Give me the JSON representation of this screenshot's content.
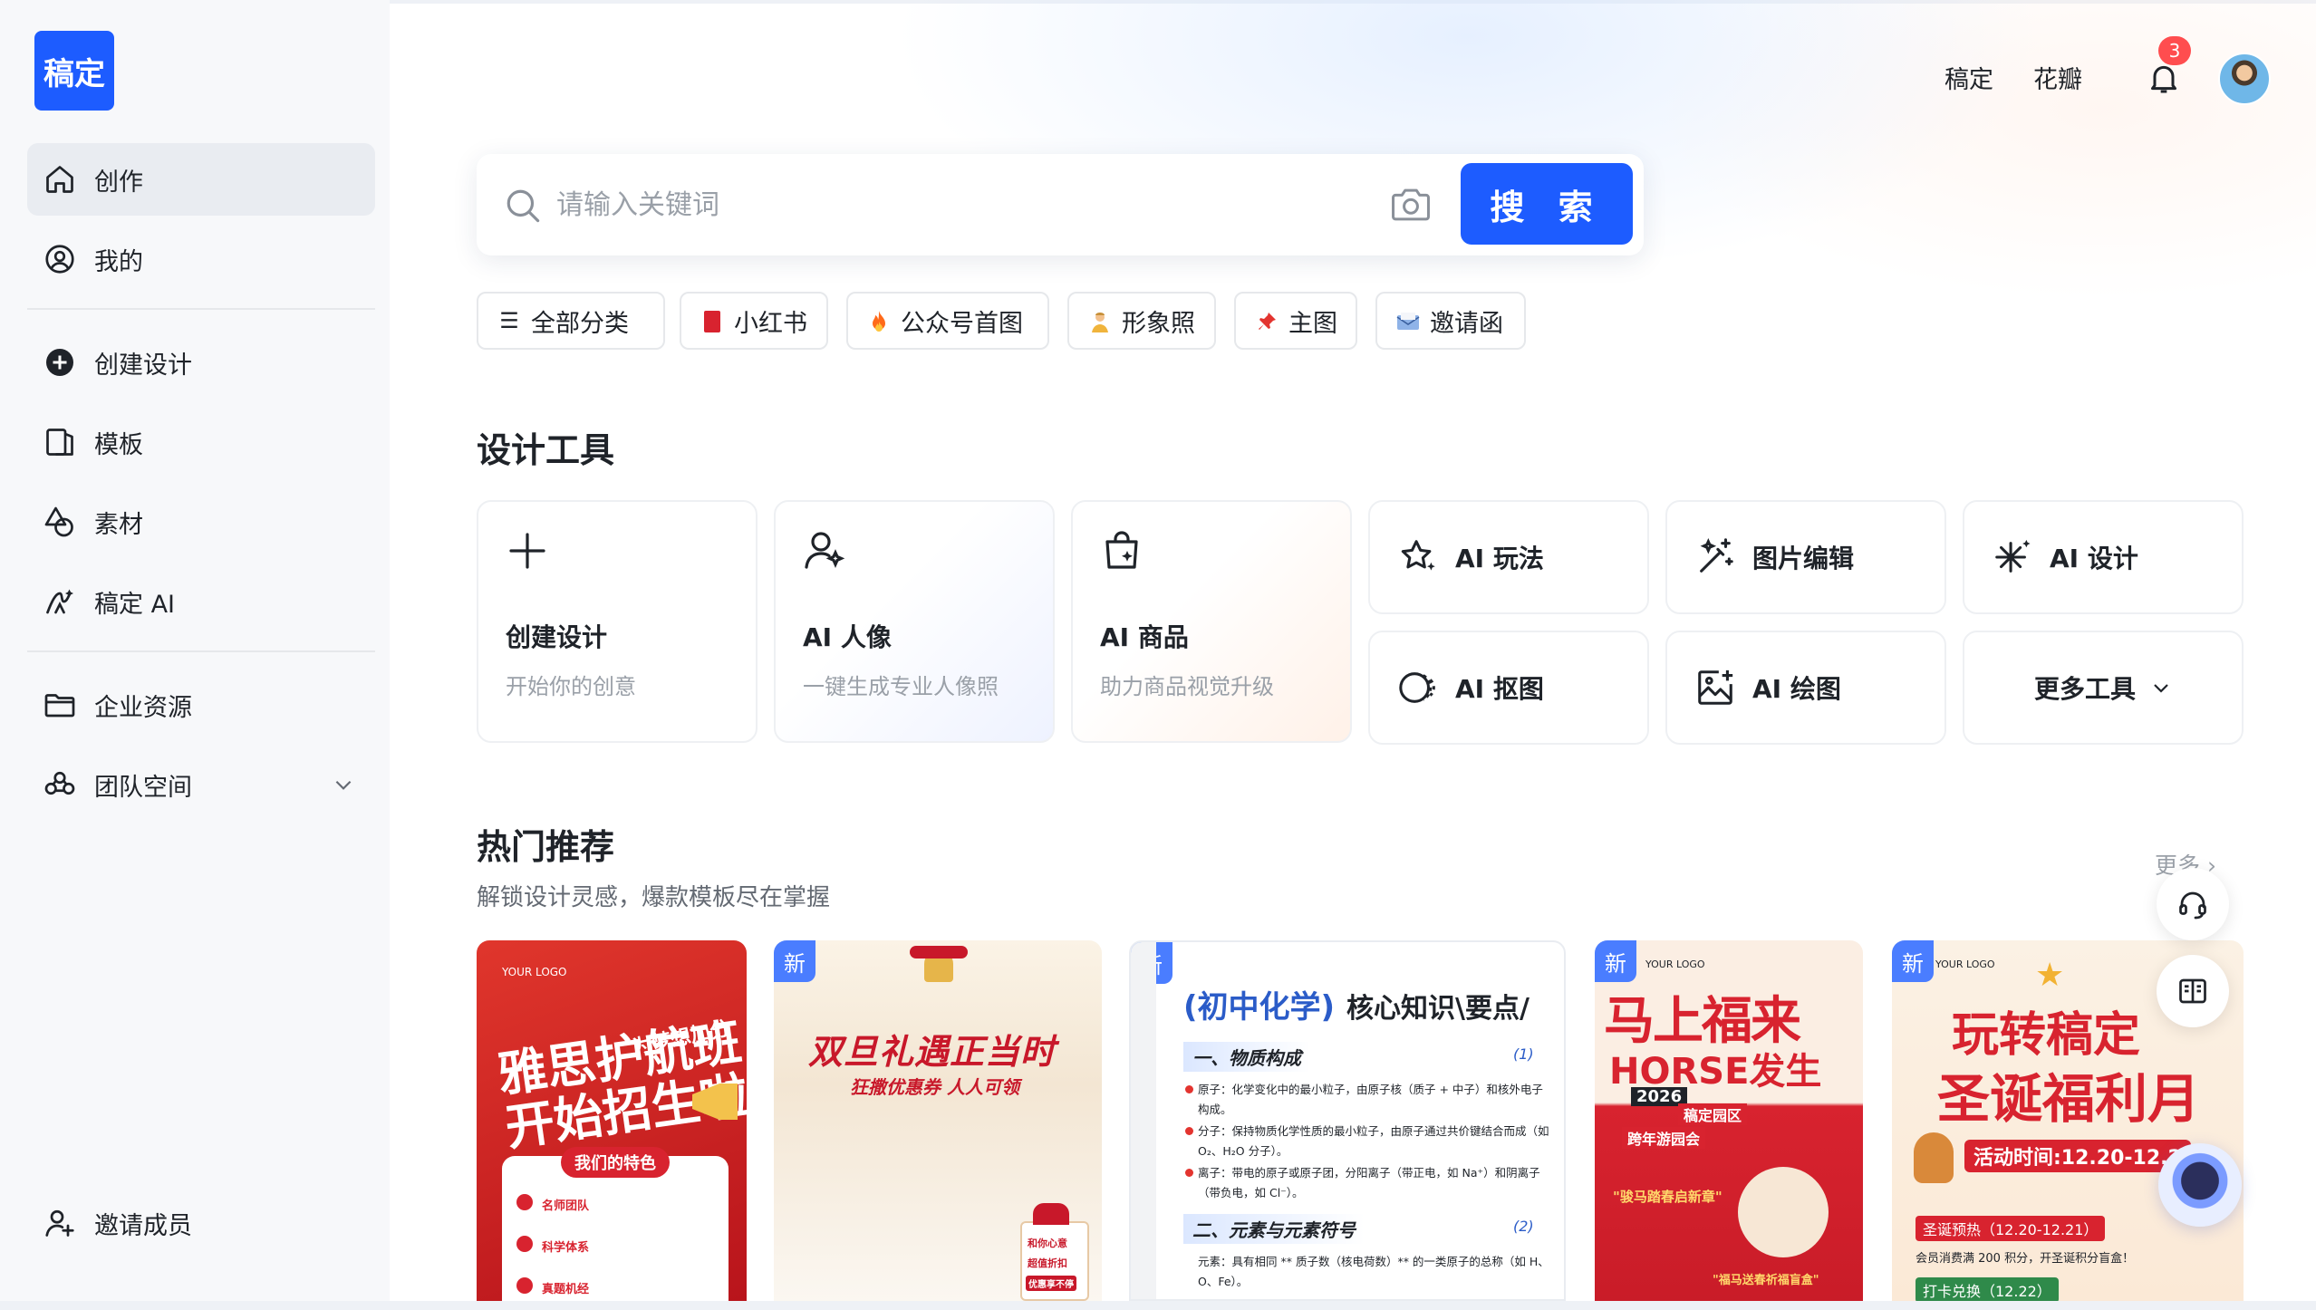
{
  "brand": {
    "logo_text": "稿定",
    "accent": "#1d5cff"
  },
  "sidebar": {
    "items": [
      {
        "label": "创作",
        "icon": "home-icon",
        "active": true
      },
      {
        "label": "我的",
        "icon": "user-circle-icon"
      },
      {
        "label": "创建设计",
        "icon": "plus-circle-icon"
      },
      {
        "label": "模板",
        "icon": "template-icon"
      },
      {
        "label": "素材",
        "icon": "shapes-icon"
      },
      {
        "label": "稿定 AI",
        "icon": "ai-brush-icon"
      },
      {
        "label": "企业资源",
        "icon": "folder-icon"
      },
      {
        "label": "团队空间",
        "icon": "team-icon"
      }
    ],
    "invite_label": "邀请成员"
  },
  "header": {
    "links": [
      "稿定",
      "花瓣"
    ],
    "notification_count": "3"
  },
  "search": {
    "placeholder": "请输入关键词",
    "button_label": "搜 索"
  },
  "chips": [
    {
      "label": "全部分类",
      "icon": "menu-icon"
    },
    {
      "label": "小红书",
      "icon": "red-book-icon"
    },
    {
      "label": "公众号首图",
      "icon": "fire-icon"
    },
    {
      "label": "形象照",
      "icon": "person-icon"
    },
    {
      "label": "主图",
      "icon": "pin-icon"
    },
    {
      "label": "邀请函",
      "icon": "envelope-icon"
    }
  ],
  "tools": {
    "title": "设计工具",
    "big": [
      {
        "name": "创建设计",
        "desc": "开始你的创意",
        "icon": "plus-icon"
      },
      {
        "name": "AI 人像",
        "desc": "一键生成专业人像照",
        "icon": "ai-portrait-icon"
      },
      {
        "name": "AI 商品",
        "desc": "助力商品视觉升级",
        "icon": "shopping-bag-icon"
      }
    ],
    "small": [
      {
        "name": "AI 玩法",
        "icon": "sparkle-star-icon"
      },
      {
        "name": "图片编辑",
        "icon": "magic-wand-icon"
      },
      {
        "name": "AI 设计",
        "icon": "ai-spark-icon"
      },
      {
        "name": "AI 抠图",
        "icon": "cutout-icon"
      },
      {
        "name": "AI 绘图",
        "icon": "image-plus-icon"
      },
      {
        "name": "更多工具",
        "icon": "chevron-down-icon"
      }
    ]
  },
  "hot": {
    "title": "热门推荐",
    "subtitle": "解锁设计灵感，爆款模板尽在掌握",
    "more_label": "更多",
    "new_label": "新",
    "cards": [
      {
        "lines": [
          "雅思护航班",
          "开始招生啦"
        ],
        "logo": "YOUR LOGO",
        "tag": "为梦想加分",
        "feature_title": "我们的特色",
        "features": [
          "名师团队",
          "科学体系",
          "真题机经"
        ]
      },
      {
        "lines": [
          "双旦礼遇正当时",
          "狂撒优惠券 人人可领"
        ],
        "gift": "和你心意",
        "gift2": "超值折扣",
        "gift3": "优惠享不停"
      },
      {
        "title_a": "(初中化学)",
        "title_b": "核心知识\\要点/",
        "sec1": "一、物质构成",
        "sec1_no": "(1)",
        "bullets": [
          "原子：化学变化中的最小粒子，由原子核（质子 + 中子）和核外电子构成。",
          "分子：保持物质化学性质的最小粒子，由原子通过共价键结合而成（如 O₂、H₂O 分子）。",
          "离子：带电的原子或原子团，分阳离子（带正电，如 Na⁺）和阴离子（带负电，如 Cl⁻）。"
        ],
        "sec2": "二、元素与元素符号",
        "sec2_no": "(2)",
        "bullet2": "元素：具有相同 ** 质子数（核电荷数）** 的一类原子的总称（如 H、O、Fe）。"
      },
      {
        "lines": [
          "马上福来",
          "HORSE发生"
        ],
        "logo": "YOUR LOGO",
        "year": "2026",
        "tag1": "稿定园区",
        "tag2": "跨年游园会",
        "act1": "\"骏马踏春启新章\"",
        "act2": "\"福马送春祈福盲盒\""
      },
      {
        "lines": [
          "玩转稿定",
          "圣诞福利月"
        ],
        "logo": "YOUR LOGO",
        "time": "活动时间:12.20-12.2",
        "pre": "圣诞预热（12.20-12.21）",
        "desc": "会员消费满 200 积分，开圣诞积分盲盒！",
        "checkin": "打卡兑换（12.22）"
      }
    ]
  }
}
